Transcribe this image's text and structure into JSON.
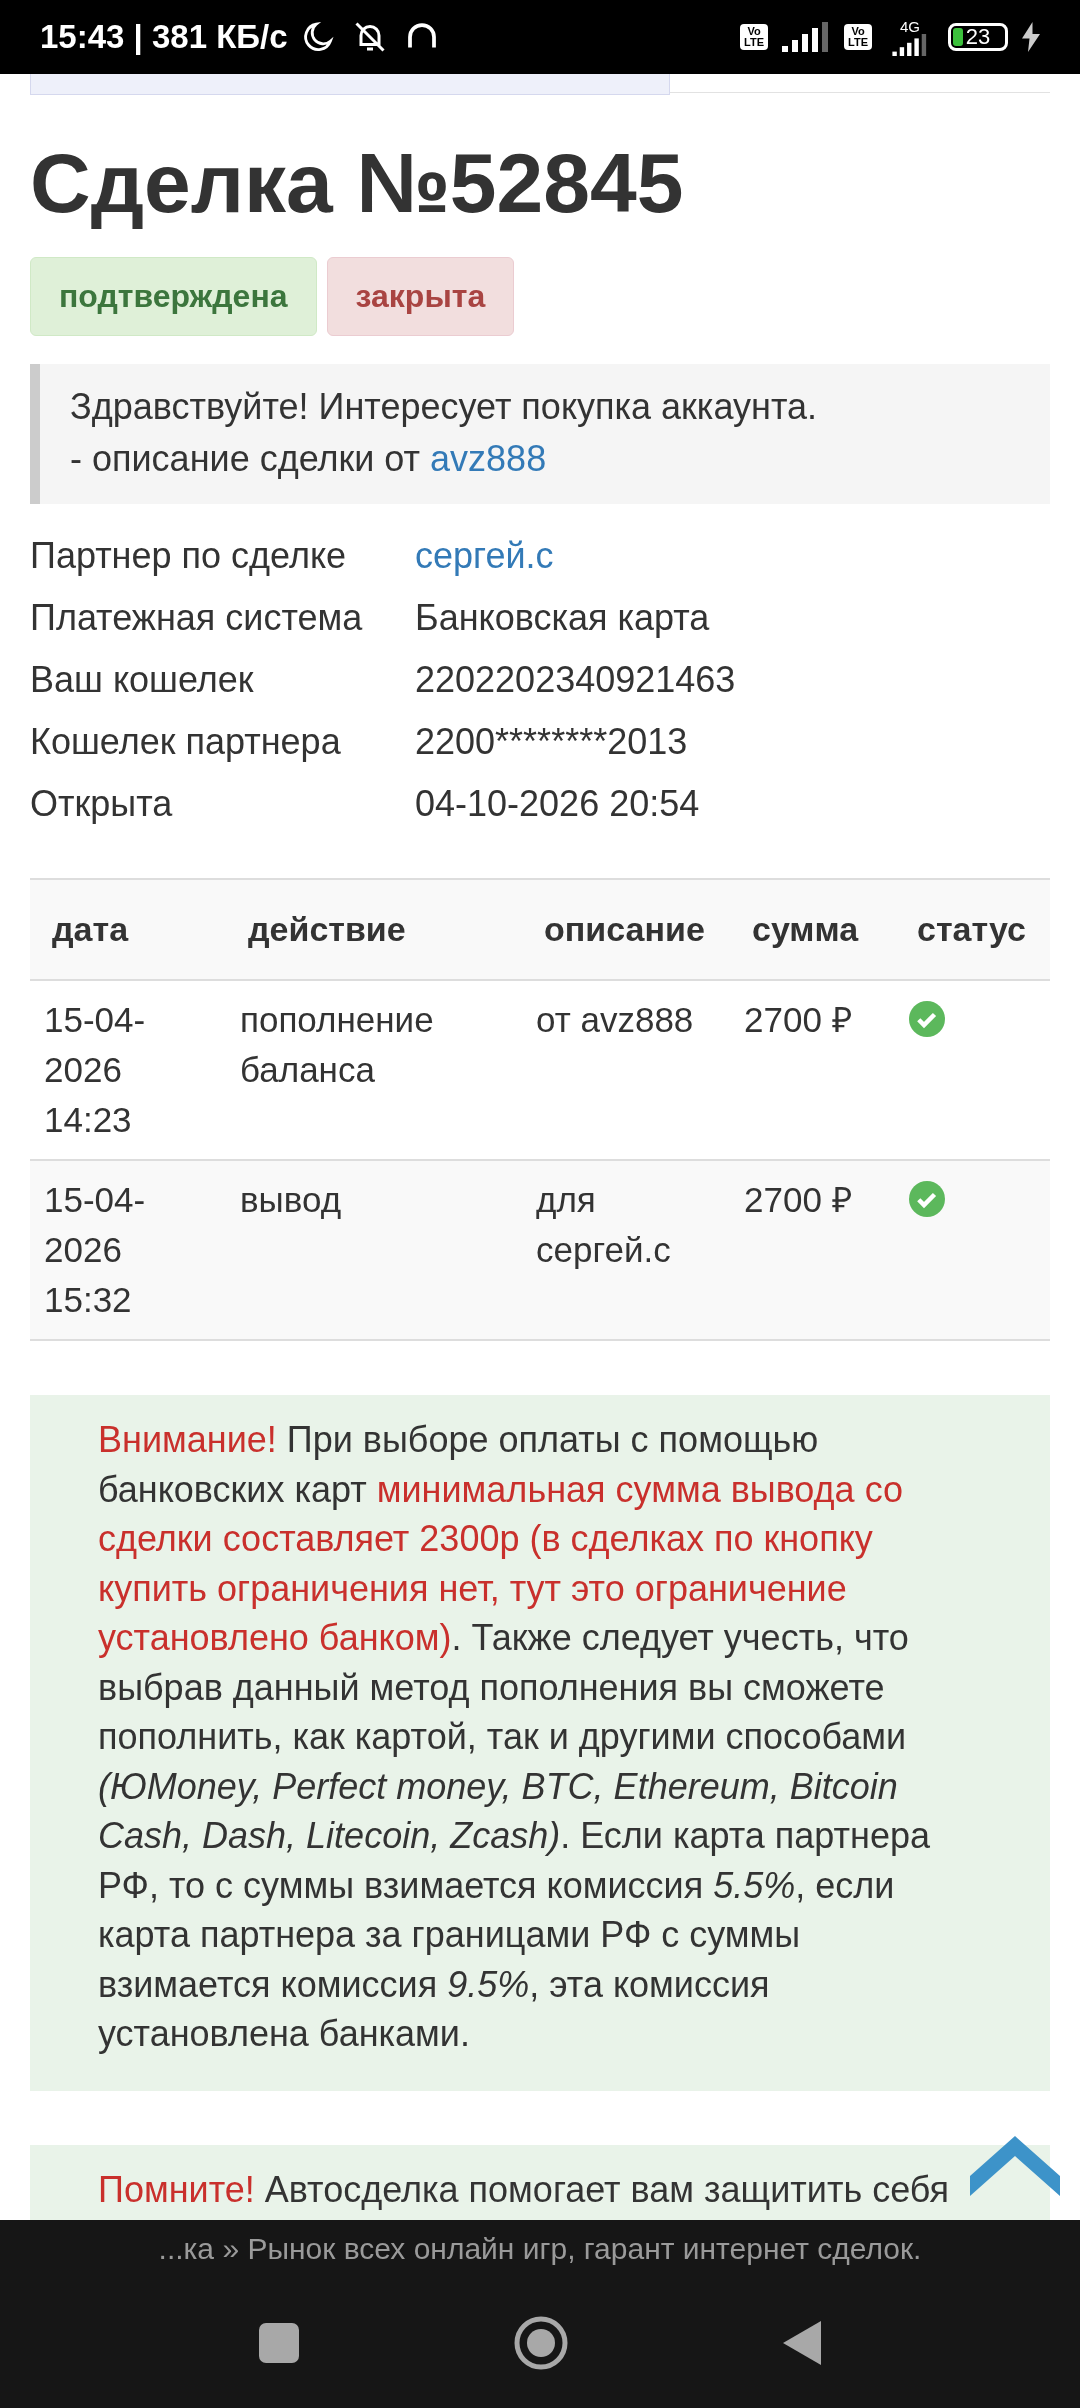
{
  "status_bar": {
    "time": "15:43 | 381 КБ/с",
    "volte_labels": [
      [
        "Vo",
        "LTE"
      ],
      [
        "Vo",
        "LTE"
      ]
    ],
    "network": "4G",
    "battery": "23",
    "charging": true
  },
  "deal": {
    "title": "Сделка №52845",
    "badges": [
      {
        "label": "подтверждена",
        "kind": "success"
      },
      {
        "label": "закрыта",
        "kind": "danger"
      }
    ],
    "quote": {
      "text": "Здравствуйте! Интересует покупка аккаунта.",
      "caption": "- описание сделки от ",
      "author": "avz888"
    },
    "details": [
      {
        "label": "Партнер по сделке",
        "value": "сергей.с",
        "kind": "link"
      },
      {
        "label": "Платежная система",
        "value": "Банковская карта",
        "kind": "text"
      },
      {
        "label": "Ваш кошелек",
        "value": "2202202340921463",
        "kind": "text"
      },
      {
        "label": "Кошелек партнера",
        "value": "2200********2013",
        "kind": "text"
      },
      {
        "label": "Открыта",
        "value": "04-10-2026 20:54",
        "kind": "text"
      }
    ]
  },
  "table": {
    "columns": [
      "дата",
      "действие",
      "описание",
      "сумма",
      "статус"
    ],
    "rows": [
      {
        "date": "15-04-2026 14:23",
        "action": "пополнение баланса",
        "description": "от avz888",
        "amount": "2700 ₽",
        "completed": true
      },
      {
        "date": "15-04-2026 15:32",
        "action": "вывод",
        "description": "для сергей.с",
        "amount": "2700 ₽",
        "completed": true
      }
    ]
  },
  "notices": [
    {
      "segments": [
        {
          "text": "Внимание!",
          "kind": "red"
        },
        {
          "text": " При выборе оплаты с помощью банковских карт ",
          "kind": "plain"
        },
        {
          "text": "минимальная сумма вывода со сделки составляет 2300р (в сделках по кнопку купить ограничения нет, тут это ограничение установлено банком)",
          "kind": "red"
        },
        {
          "text": ". Также следует учесть, что выбрав данный метод пополнения вы сможете пополнить, как картой, так и другими способами ",
          "kind": "plain"
        },
        {
          "text": "(ЮMoney, Perfect money, BTC, Ethereum, Bitcoin Cash, Dash, Litecoin, Zcash)",
          "kind": "italic"
        },
        {
          "text": ". Если карта партнера РФ, то с суммы взимается комиссия ",
          "kind": "plain"
        },
        {
          "text": "5.5%",
          "kind": "italic"
        },
        {
          "text": ", если карта партнера за границами РФ с суммы взимается комиссия ",
          "kind": "plain"
        },
        {
          "text": "9.5%",
          "kind": "italic"
        },
        {
          "text": ", эта комиссия установлена банками.",
          "kind": "plain"
        }
      ]
    },
    {
      "segments": [
        {
          "text": "Помните!",
          "kind": "red"
        },
        {
          "text": " Автосделка помогает вам защитить себя",
          "kind": "plain"
        }
      ]
    }
  ],
  "browser_bar": {
    "page_title": "...ка » Рынок всех онлайн игр, гарант интернет сделок."
  }
}
